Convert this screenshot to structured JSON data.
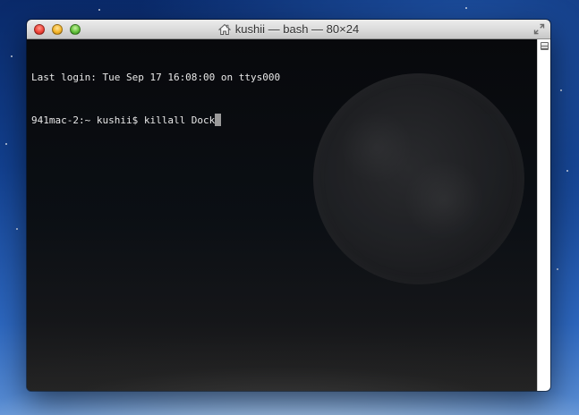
{
  "window": {
    "title": "kushii — bash — 80×24"
  },
  "terminal": {
    "lines": [
      "Last login: Tue Sep 17 16:08:00 on ttys000",
      "941mac-2:~ kushii$ killall Dock"
    ]
  },
  "icons": {
    "title": "home-icon",
    "fullscreen": "fullscreen-icon",
    "split": "split-pane-icon"
  },
  "colors": {
    "close": "#f0443a",
    "minimize": "#f5b62a",
    "zoom": "#62c23b",
    "terminal_text": "#e8e8e8"
  }
}
